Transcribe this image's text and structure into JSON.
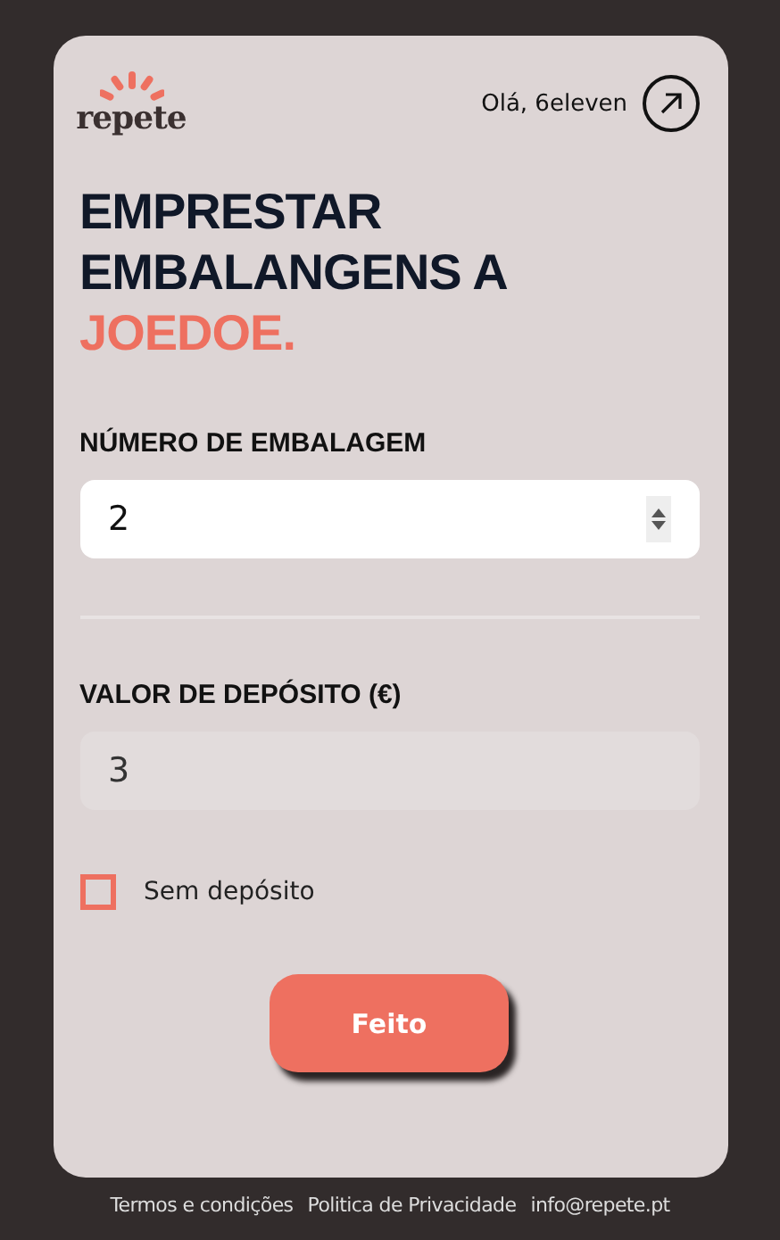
{
  "header": {
    "logo": "repete",
    "greeting": "Olá, 6eleven"
  },
  "title": {
    "text": "EMPRESTAR EMBALANGENS A",
    "highlight": "JOEDOE."
  },
  "fields": [
    {
      "label": "NÚMERO DE EMBALAGEM",
      "value": "2",
      "kind": "number",
      "disabled": false
    },
    {
      "label": "VALOR DE DEPÓSITO (€)",
      "value": "3",
      "kind": "text",
      "disabled": true
    }
  ],
  "checkbox": {
    "label": "Sem depósito",
    "checked": false
  },
  "submit": "Feito",
  "footer": [
    "Termos e condições",
    "Politica de Privacidade",
    "info@repete.pt"
  ]
}
